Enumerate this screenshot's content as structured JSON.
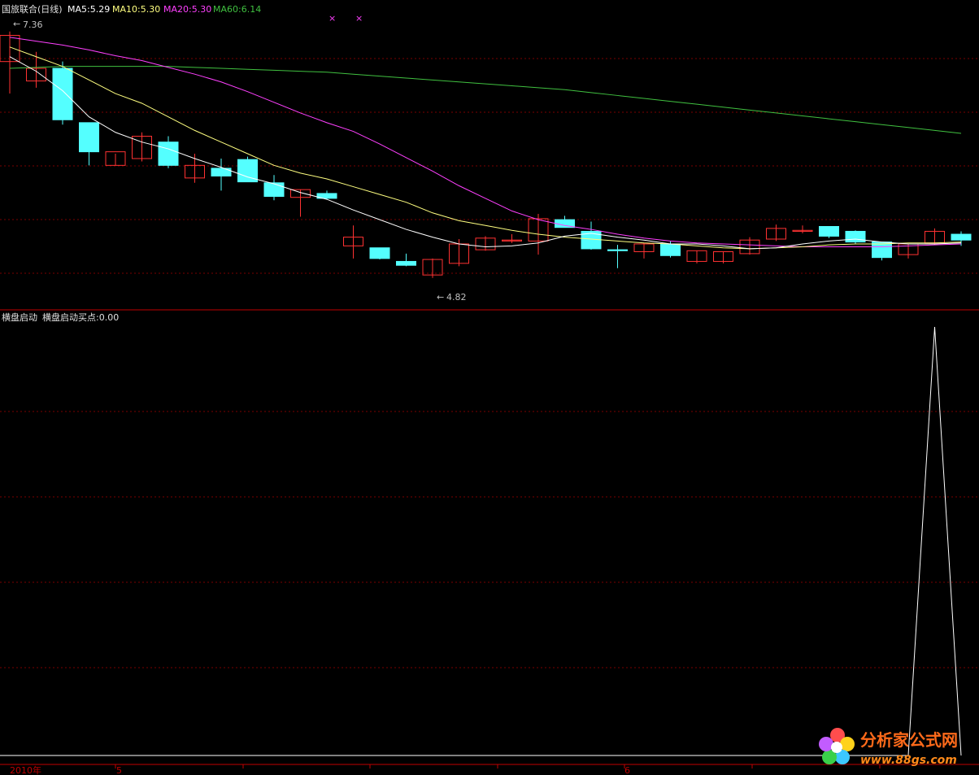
{
  "header": {
    "stock": "国旅联合(日线)",
    "ma5": "MA5:5.29",
    "ma10": "MA10:5.30",
    "ma20": "MA20:5.30",
    "ma60": "MA60:6.14"
  },
  "indicator": {
    "name": "横盘启动",
    "value_label": "横盘启动买点:0.00"
  },
  "annotations": {
    "high": "7.36",
    "low": "4.82"
  },
  "xaxis": {
    "year": "2010年",
    "month1": "5",
    "month2": "6"
  },
  "watermark": {
    "title": "分析家公式网",
    "url": "www.88gs.com"
  },
  "colors": {
    "up": "#ff3232",
    "down": "#54ffff",
    "ma5": "#ffffff",
    "ma10": "#ffff80",
    "ma20": "#ff40ff",
    "ma60": "#40c040",
    "axis": "#c00000",
    "grid": "#7a0000",
    "indicator": "#ffffff"
  },
  "chart_data": [
    {
      "type": "candlestick",
      "ylim": [
        4.65,
        7.5
      ],
      "candles": [
        {
          "o": 7.05,
          "h": 7.36,
          "l": 6.72,
          "c": 7.32
        },
        {
          "o": 6.85,
          "h": 7.15,
          "l": 6.78,
          "c": 6.98
        },
        {
          "o": 6.98,
          "h": 7.05,
          "l": 6.4,
          "c": 6.45
        },
        {
          "o": 6.42,
          "h": 6.42,
          "l": 5.98,
          "c": 6.12
        },
        {
          "o": 5.98,
          "h": 6.1,
          "l": 5.98,
          "c": 6.12
        },
        {
          "o": 6.05,
          "h": 6.32,
          "l": 6.02,
          "c": 6.28
        },
        {
          "o": 6.22,
          "h": 6.28,
          "l": 5.95,
          "c": 5.98
        },
        {
          "o": 5.85,
          "h": 6.1,
          "l": 5.8,
          "c": 5.98
        },
        {
          "o": 5.95,
          "h": 6.05,
          "l": 5.72,
          "c": 5.87
        },
        {
          "o": 6.04,
          "h": 6.07,
          "l": 5.81,
          "c": 5.81
        },
        {
          "o": 5.8,
          "h": 5.88,
          "l": 5.62,
          "c": 5.66
        },
        {
          "o": 5.65,
          "h": 5.73,
          "l": 5.45,
          "c": 5.73
        },
        {
          "o": 5.69,
          "h": 5.72,
          "l": 5.63,
          "c": 5.64
        },
        {
          "o": 5.15,
          "h": 5.36,
          "l": 5.02,
          "c": 5.24
        },
        {
          "o": 5.13,
          "h": 5.13,
          "l": 5.01,
          "c": 5.02
        },
        {
          "o": 4.99,
          "h": 5.07,
          "l": 4.94,
          "c": 4.95
        },
        {
          "o": 4.85,
          "h": 5.02,
          "l": 4.82,
          "c": 5.01
        },
        {
          "o": 4.97,
          "h": 5.22,
          "l": 4.94,
          "c": 5.17
        },
        {
          "o": 5.11,
          "h": 5.25,
          "l": 5.1,
          "c": 5.23
        },
        {
          "o": 5.2,
          "h": 5.27,
          "l": 5.18,
          "c": 5.21
        },
        {
          "o": 5.2,
          "h": 5.48,
          "l": 5.06,
          "c": 5.43
        },
        {
          "o": 5.42,
          "h": 5.46,
          "l": 5.34,
          "c": 5.34
        },
        {
          "o": 5.3,
          "h": 5.4,
          "l": 5.11,
          "c": 5.12
        },
        {
          "o": 5.11,
          "h": 5.16,
          "l": 4.92,
          "c": 5.1
        },
        {
          "o": 5.09,
          "h": 5.18,
          "l": 5.02,
          "c": 5.17
        },
        {
          "o": 5.17,
          "h": 5.2,
          "l": 5.03,
          "c": 5.05
        },
        {
          "o": 4.99,
          "h": 5.1,
          "l": 4.97,
          "c": 5.1
        },
        {
          "o": 4.99,
          "h": 5.09,
          "l": 4.97,
          "c": 5.09
        },
        {
          "o": 5.07,
          "h": 5.24,
          "l": 5.06,
          "c": 5.21
        },
        {
          "o": 5.22,
          "h": 5.37,
          "l": 5.2,
          "c": 5.33
        },
        {
          "o": 5.3,
          "h": 5.36,
          "l": 5.28,
          "c": 5.31
        },
        {
          "o": 5.35,
          "h": 5.35,
          "l": 5.23,
          "c": 5.25
        },
        {
          "o": 5.3,
          "h": 5.31,
          "l": 5.17,
          "c": 5.19
        },
        {
          "o": 5.19,
          "h": 5.19,
          "l": 5.0,
          "c": 5.03
        },
        {
          "o": 5.06,
          "h": 5.17,
          "l": 5.02,
          "c": 5.17
        },
        {
          "o": 5.18,
          "h": 5.33,
          "l": 5.16,
          "c": 5.3
        },
        {
          "o": 5.27,
          "h": 5.3,
          "l": 5.15,
          "c": 5.21
        }
      ],
      "ma5": [
        7.1,
        6.95,
        6.75,
        6.48,
        6.32,
        6.22,
        6.15,
        6.05,
        5.96,
        5.86,
        5.79,
        5.7,
        5.63,
        5.52,
        5.42,
        5.32,
        5.24,
        5.17,
        5.14,
        5.15,
        5.18,
        5.25,
        5.28,
        5.24,
        5.21,
        5.17,
        5.17,
        5.15,
        5.12,
        5.13,
        5.17,
        5.2,
        5.22,
        5.19,
        5.17,
        5.17,
        5.18
      ],
      "ma10": [
        7.2,
        7.1,
        7.0,
        6.86,
        6.72,
        6.62,
        6.48,
        6.34,
        6.22,
        6.1,
        5.98,
        5.9,
        5.84,
        5.76,
        5.68,
        5.6,
        5.49,
        5.41,
        5.36,
        5.31,
        5.27,
        5.24,
        5.22,
        5.2,
        5.18,
        5.17,
        5.15,
        5.13,
        5.12,
        5.13,
        5.14,
        5.16,
        5.17,
        5.17,
        5.18,
        5.18,
        5.19
      ],
      "ma20": [
        7.3,
        7.26,
        7.22,
        7.17,
        7.11,
        7.06,
        6.99,
        6.92,
        6.84,
        6.74,
        6.63,
        6.52,
        6.42,
        6.33,
        6.2,
        6.06,
        5.92,
        5.77,
        5.64,
        5.51,
        5.42,
        5.36,
        5.32,
        5.27,
        5.23,
        5.2,
        5.18,
        5.17,
        5.16,
        5.15,
        5.14,
        5.14,
        5.14,
        5.14,
        5.15,
        5.16,
        5.17
      ],
      "ma60": [
        6.98,
        6.99,
        7.0,
        7.0,
        7.0,
        7.0,
        7.0,
        6.99,
        6.98,
        6.97,
        6.96,
        6.95,
        6.94,
        6.92,
        6.9,
        6.88,
        6.86,
        6.84,
        6.82,
        6.8,
        6.78,
        6.76,
        6.73,
        6.7,
        6.67,
        6.64,
        6.61,
        6.58,
        6.55,
        6.52,
        6.49,
        6.46,
        6.43,
        6.4,
        6.37,
        6.34,
        6.31
      ]
    },
    {
      "type": "line",
      "series": [
        {
          "values": [
            0,
            0,
            0,
            0,
            0,
            0,
            0,
            0,
            0,
            0,
            0,
            0,
            0,
            0,
            0,
            0,
            0,
            0,
            0,
            0,
            0,
            0,
            0,
            0,
            0,
            0,
            0,
            0,
            0,
            0,
            0,
            0,
            0,
            0,
            0,
            1,
            0
          ]
        }
      ],
      "ylim": [
        0,
        1
      ]
    }
  ]
}
